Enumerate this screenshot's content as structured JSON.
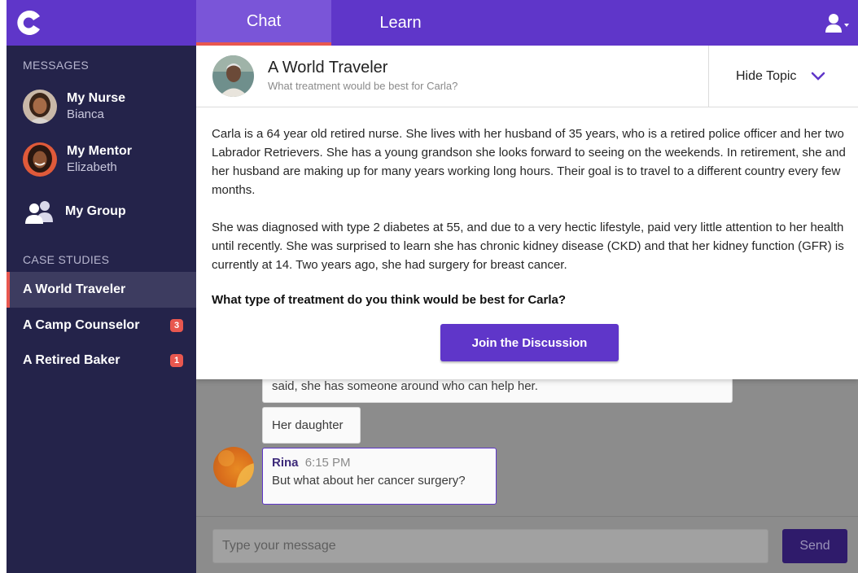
{
  "app": {
    "logo_letter": "C"
  },
  "colors": {
    "brand": "#5f36c9",
    "sidebar": "#24234a",
    "accent": "#e8574f"
  },
  "header": {
    "tabs": [
      {
        "label": "Chat",
        "active": true
      },
      {
        "label": "Learn",
        "active": false
      }
    ],
    "user_icon": "user-icon"
  },
  "sidebar": {
    "messages_label": "MESSAGES",
    "messages": [
      {
        "name": "My Nurse",
        "sub": "Bianca"
      },
      {
        "name": "My Mentor",
        "sub": "Elizabeth"
      }
    ],
    "group": {
      "label": "My Group",
      "icon": "group-icon"
    },
    "case_studies_label": "CASE STUDIES",
    "case_studies": [
      {
        "label": "A World Traveler",
        "badge": "",
        "active": true
      },
      {
        "label": "A Camp Counselor",
        "badge": "3",
        "active": false
      },
      {
        "label": "A Retired Baker",
        "badge": "1",
        "active": false
      }
    ]
  },
  "topic": {
    "title": "A World Traveler",
    "subtitle": "What treatment would be best for Carla?",
    "hide_label": "Hide Topic",
    "paragraphs": [
      "Carla is a 64 year old retired nurse. She lives with her husband of 35 years, who is a retired police officer and her two Labrador Retrievers. She has a young grandson she looks forward to seeing on the weekends. In retirement, she and her husband are making up for many years working long hours. Their goal is to travel to a different country every few months.",
      "She was diagnosed with type 2 diabetes at 55, and due to a very hectic lifestyle, paid very little attention to her health until recently. She was surprised to learn she has chronic kidney disease (CKD) and that her kidney function (GFR) is currently at 14. Two years ago, she had surgery for breast cancer."
    ],
    "question": "What type of treatment do you think would be best for Carla?",
    "join_label": "Join the Discussion"
  },
  "chat": {
    "messages": [
      {
        "text": "said, she has someone around who can help her."
      },
      {
        "text": "Her daughter"
      },
      {
        "author": "Rina",
        "time": "6:15 PM",
        "text": "But what about her cancer surgery?"
      }
    ],
    "input_placeholder": "Type your message",
    "send_label": "Send"
  }
}
